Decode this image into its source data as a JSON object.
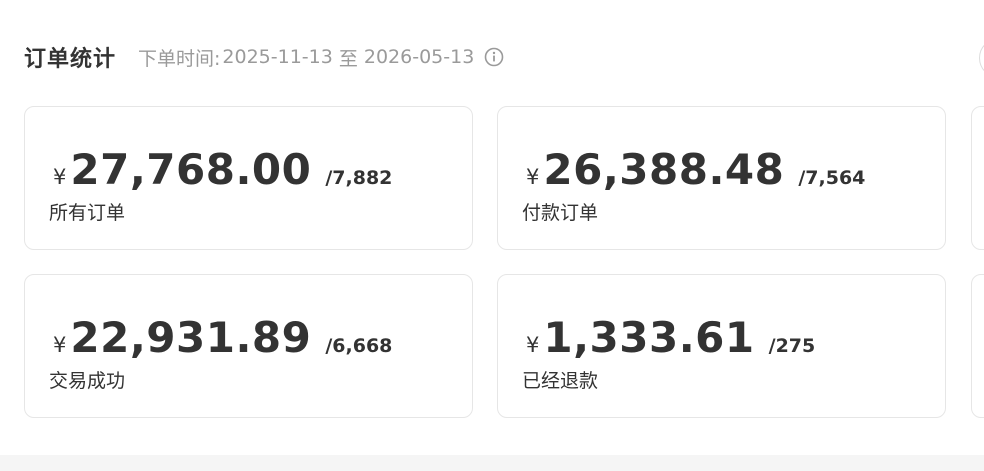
{
  "header": {
    "title": "订单统计",
    "date_label": "下单时间:",
    "date_start": "2025-11-13",
    "date_separator": "至",
    "date_end": "2026-05-13",
    "info_icon": "info-circle-icon"
  },
  "cards": [
    {
      "currency": "¥",
      "amount": "27,768.00",
      "count": "/7,882",
      "label": "所有订单"
    },
    {
      "currency": "¥",
      "amount": "26,388.48",
      "count": "/7,564",
      "label": "付款订单"
    },
    {
      "currency": "¥",
      "amount": "22,931.89",
      "count": "/6,668",
      "label": "交易成功"
    },
    {
      "currency": "¥",
      "amount": "1,333.61",
      "count": "/275",
      "label": "已经退款"
    }
  ],
  "colors": {
    "text_primary": "#333333",
    "text_secondary": "#9a9a9a",
    "border": "#e6e6e6",
    "footer_bg": "#f5f5f5"
  }
}
